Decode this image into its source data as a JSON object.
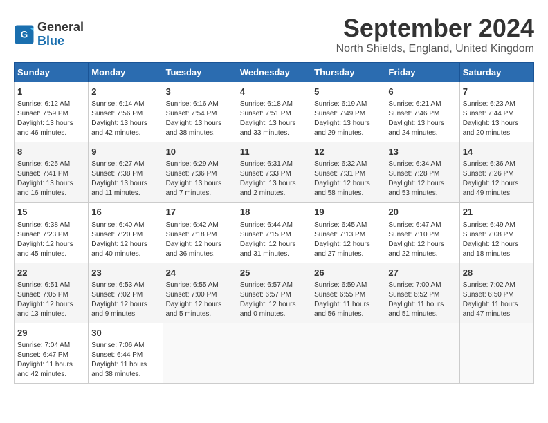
{
  "header": {
    "logo_line1": "General",
    "logo_line2": "Blue",
    "month_title": "September 2024",
    "location": "North Shields, England, United Kingdom"
  },
  "weekdays": [
    "Sunday",
    "Monday",
    "Tuesday",
    "Wednesday",
    "Thursday",
    "Friday",
    "Saturday"
  ],
  "weeks": [
    [
      {
        "day": "1",
        "info": "Sunrise: 6:12 AM\nSunset: 7:59 PM\nDaylight: 13 hours\nand 46 minutes."
      },
      {
        "day": "2",
        "info": "Sunrise: 6:14 AM\nSunset: 7:56 PM\nDaylight: 13 hours\nand 42 minutes."
      },
      {
        "day": "3",
        "info": "Sunrise: 6:16 AM\nSunset: 7:54 PM\nDaylight: 13 hours\nand 38 minutes."
      },
      {
        "day": "4",
        "info": "Sunrise: 6:18 AM\nSunset: 7:51 PM\nDaylight: 13 hours\nand 33 minutes."
      },
      {
        "day": "5",
        "info": "Sunrise: 6:19 AM\nSunset: 7:49 PM\nDaylight: 13 hours\nand 29 minutes."
      },
      {
        "day": "6",
        "info": "Sunrise: 6:21 AM\nSunset: 7:46 PM\nDaylight: 13 hours\nand 24 minutes."
      },
      {
        "day": "7",
        "info": "Sunrise: 6:23 AM\nSunset: 7:44 PM\nDaylight: 13 hours\nand 20 minutes."
      }
    ],
    [
      {
        "day": "8",
        "info": "Sunrise: 6:25 AM\nSunset: 7:41 PM\nDaylight: 13 hours\nand 16 minutes."
      },
      {
        "day": "9",
        "info": "Sunrise: 6:27 AM\nSunset: 7:38 PM\nDaylight: 13 hours\nand 11 minutes."
      },
      {
        "day": "10",
        "info": "Sunrise: 6:29 AM\nSunset: 7:36 PM\nDaylight: 13 hours\nand 7 minutes."
      },
      {
        "day": "11",
        "info": "Sunrise: 6:31 AM\nSunset: 7:33 PM\nDaylight: 13 hours\nand 2 minutes."
      },
      {
        "day": "12",
        "info": "Sunrise: 6:32 AM\nSunset: 7:31 PM\nDaylight: 12 hours\nand 58 minutes."
      },
      {
        "day": "13",
        "info": "Sunrise: 6:34 AM\nSunset: 7:28 PM\nDaylight: 12 hours\nand 53 minutes."
      },
      {
        "day": "14",
        "info": "Sunrise: 6:36 AM\nSunset: 7:26 PM\nDaylight: 12 hours\nand 49 minutes."
      }
    ],
    [
      {
        "day": "15",
        "info": "Sunrise: 6:38 AM\nSunset: 7:23 PM\nDaylight: 12 hours\nand 45 minutes."
      },
      {
        "day": "16",
        "info": "Sunrise: 6:40 AM\nSunset: 7:20 PM\nDaylight: 12 hours\nand 40 minutes."
      },
      {
        "day": "17",
        "info": "Sunrise: 6:42 AM\nSunset: 7:18 PM\nDaylight: 12 hours\nand 36 minutes."
      },
      {
        "day": "18",
        "info": "Sunrise: 6:44 AM\nSunset: 7:15 PM\nDaylight: 12 hours\nand 31 minutes."
      },
      {
        "day": "19",
        "info": "Sunrise: 6:45 AM\nSunset: 7:13 PM\nDaylight: 12 hours\nand 27 minutes."
      },
      {
        "day": "20",
        "info": "Sunrise: 6:47 AM\nSunset: 7:10 PM\nDaylight: 12 hours\nand 22 minutes."
      },
      {
        "day": "21",
        "info": "Sunrise: 6:49 AM\nSunset: 7:08 PM\nDaylight: 12 hours\nand 18 minutes."
      }
    ],
    [
      {
        "day": "22",
        "info": "Sunrise: 6:51 AM\nSunset: 7:05 PM\nDaylight: 12 hours\nand 13 minutes."
      },
      {
        "day": "23",
        "info": "Sunrise: 6:53 AM\nSunset: 7:02 PM\nDaylight: 12 hours\nand 9 minutes."
      },
      {
        "day": "24",
        "info": "Sunrise: 6:55 AM\nSunset: 7:00 PM\nDaylight: 12 hours\nand 5 minutes."
      },
      {
        "day": "25",
        "info": "Sunrise: 6:57 AM\nSunset: 6:57 PM\nDaylight: 12 hours\nand 0 minutes."
      },
      {
        "day": "26",
        "info": "Sunrise: 6:59 AM\nSunset: 6:55 PM\nDaylight: 11 hours\nand 56 minutes."
      },
      {
        "day": "27",
        "info": "Sunrise: 7:00 AM\nSunset: 6:52 PM\nDaylight: 11 hours\nand 51 minutes."
      },
      {
        "day": "28",
        "info": "Sunrise: 7:02 AM\nSunset: 6:50 PM\nDaylight: 11 hours\nand 47 minutes."
      }
    ],
    [
      {
        "day": "29",
        "info": "Sunrise: 7:04 AM\nSunset: 6:47 PM\nDaylight: 11 hours\nand 42 minutes."
      },
      {
        "day": "30",
        "info": "Sunrise: 7:06 AM\nSunset: 6:44 PM\nDaylight: 11 hours\nand 38 minutes."
      },
      {
        "day": "",
        "info": ""
      },
      {
        "day": "",
        "info": ""
      },
      {
        "day": "",
        "info": ""
      },
      {
        "day": "",
        "info": ""
      },
      {
        "day": "",
        "info": ""
      }
    ]
  ]
}
